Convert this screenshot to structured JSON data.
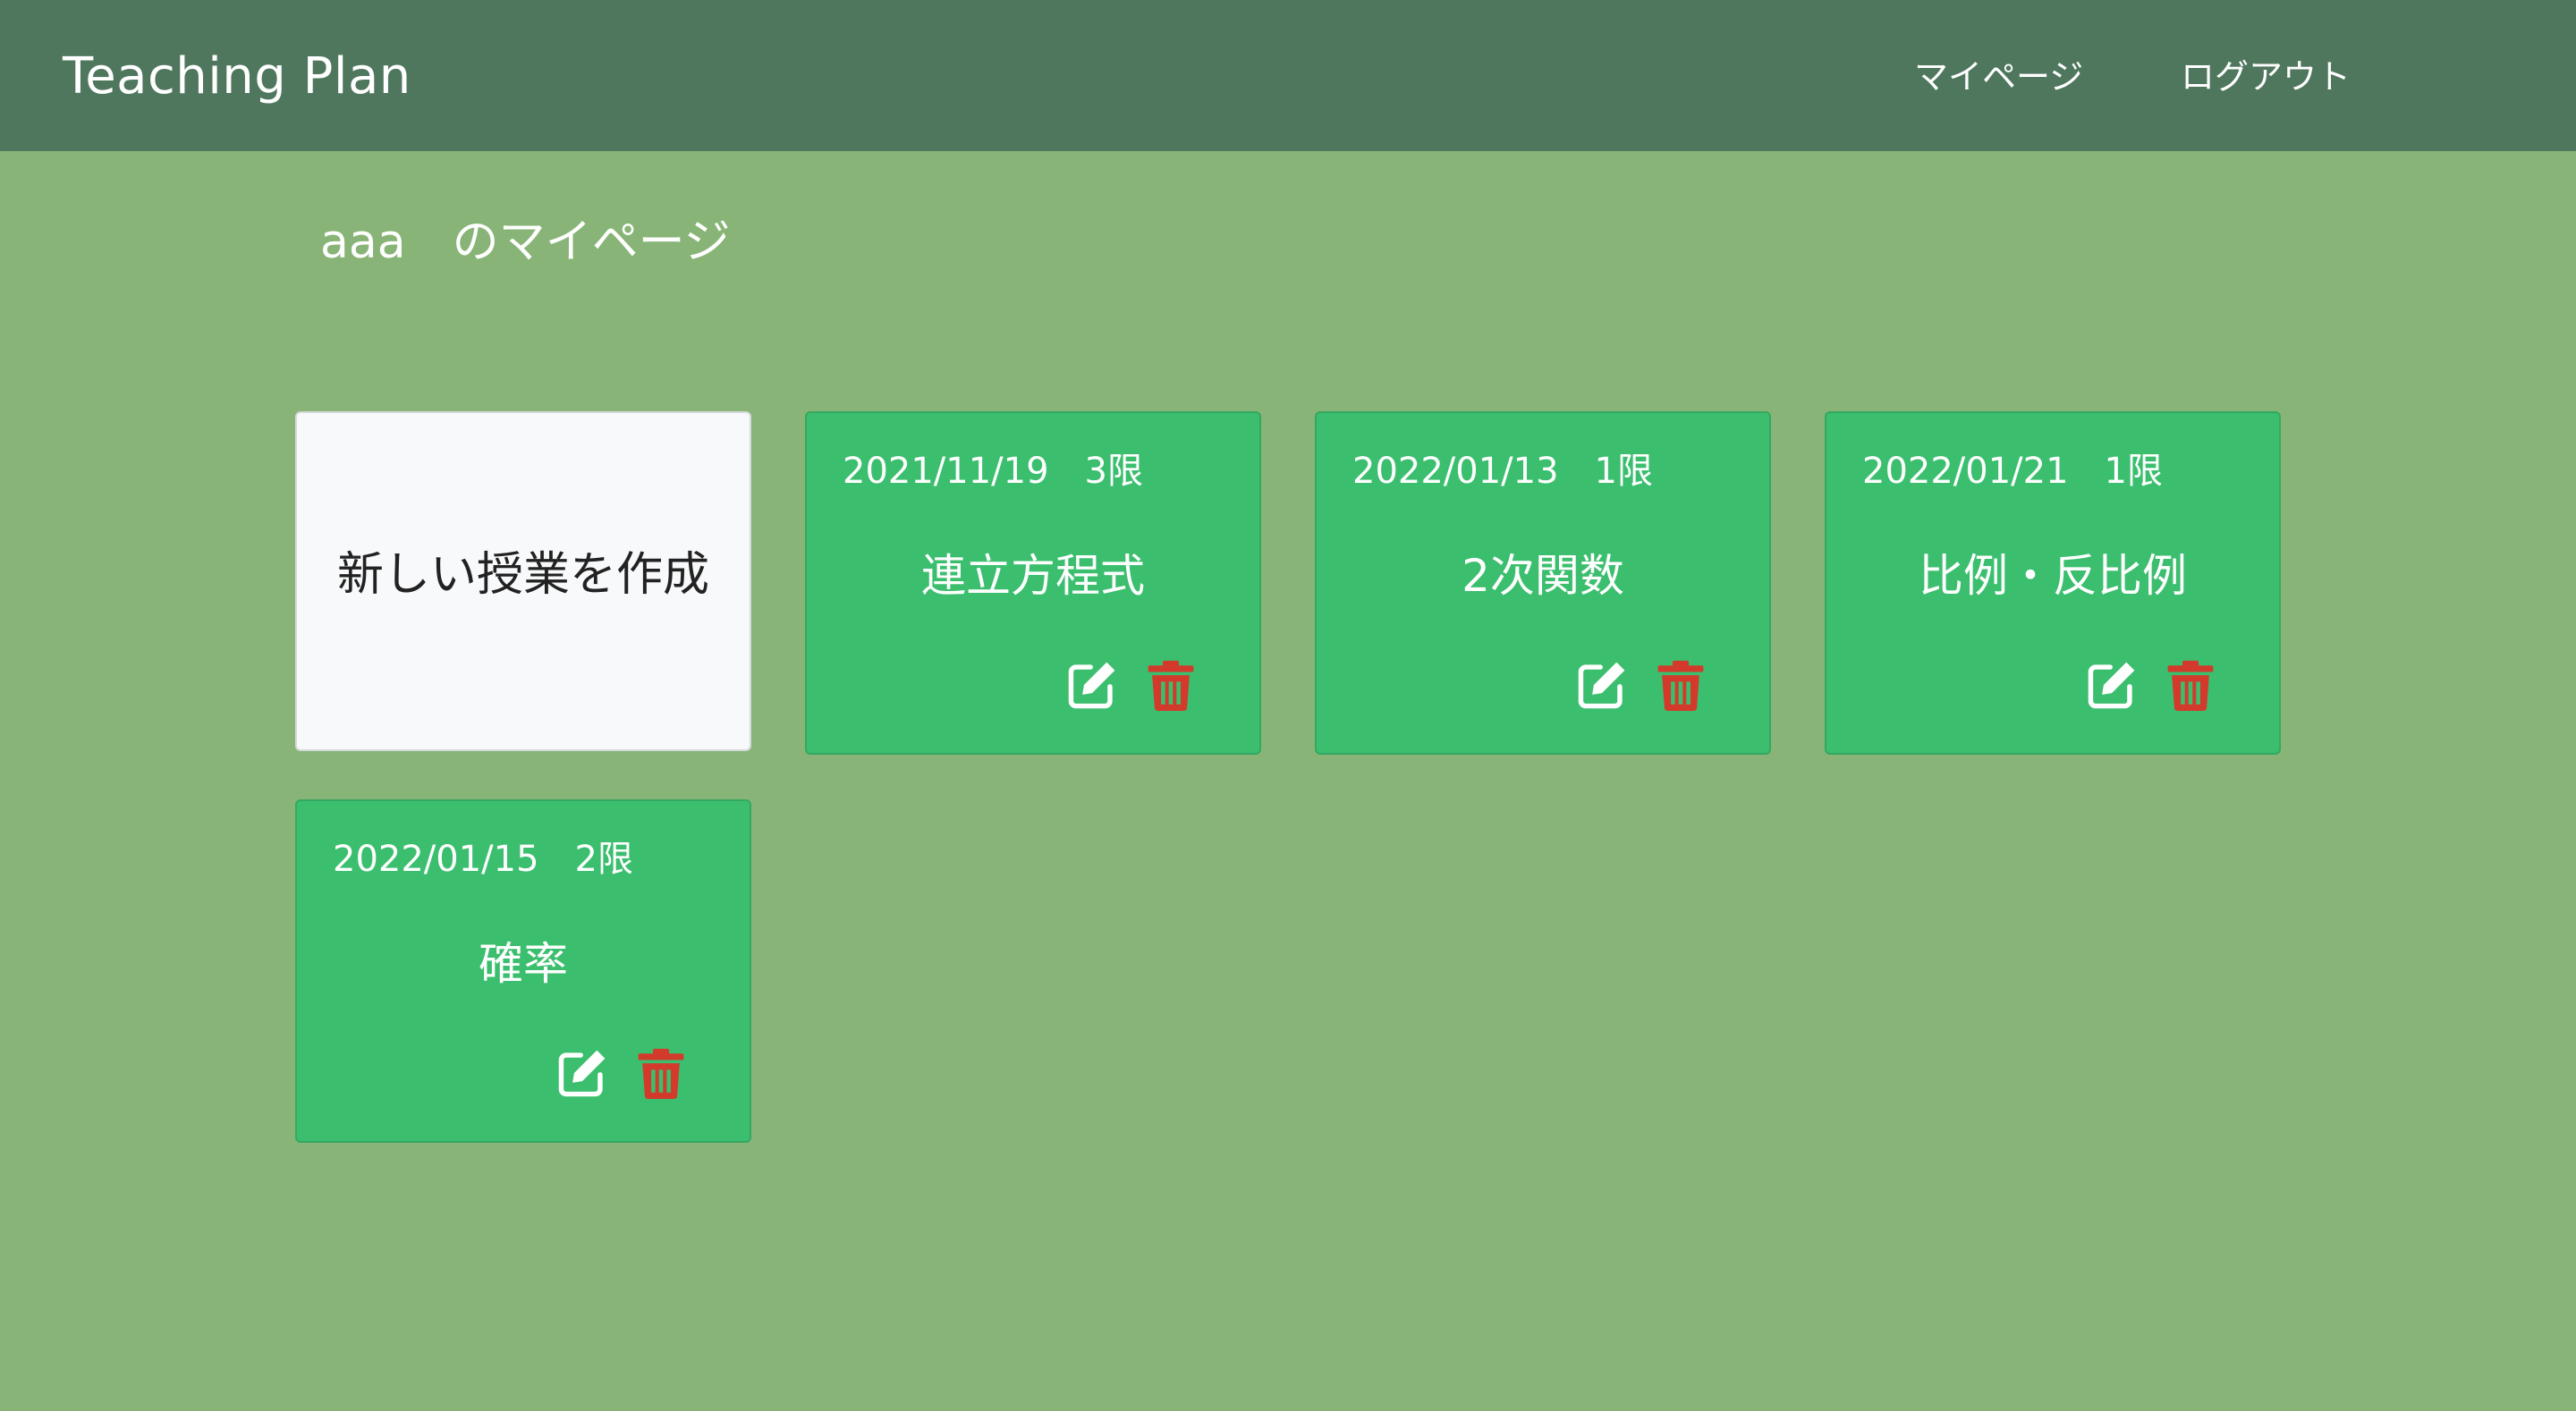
{
  "header": {
    "brand": "Teaching Plan",
    "nav": {
      "mypage": "マイページ",
      "logout": "ログアウト"
    }
  },
  "page": {
    "title": "aaa　のマイページ"
  },
  "new_card": {
    "label": "新しい授業を作成"
  },
  "lessons": [
    {
      "date": "2021/11/19　3限",
      "title": "連立方程式"
    },
    {
      "date": "2022/01/13　1限",
      "title": "2次関数"
    },
    {
      "date": "2022/01/21　1限",
      "title": "比例・反比例"
    },
    {
      "date": "2022/01/15　2限",
      "title": "確率"
    }
  ],
  "icons": {
    "edit": "edit-icon",
    "delete": "trash-icon"
  },
  "colors": {
    "background": "#88b577",
    "navbar": "#4f775e",
    "card": "#3bbf6e",
    "delete": "#d33a2c",
    "edit": "#ffffff"
  }
}
